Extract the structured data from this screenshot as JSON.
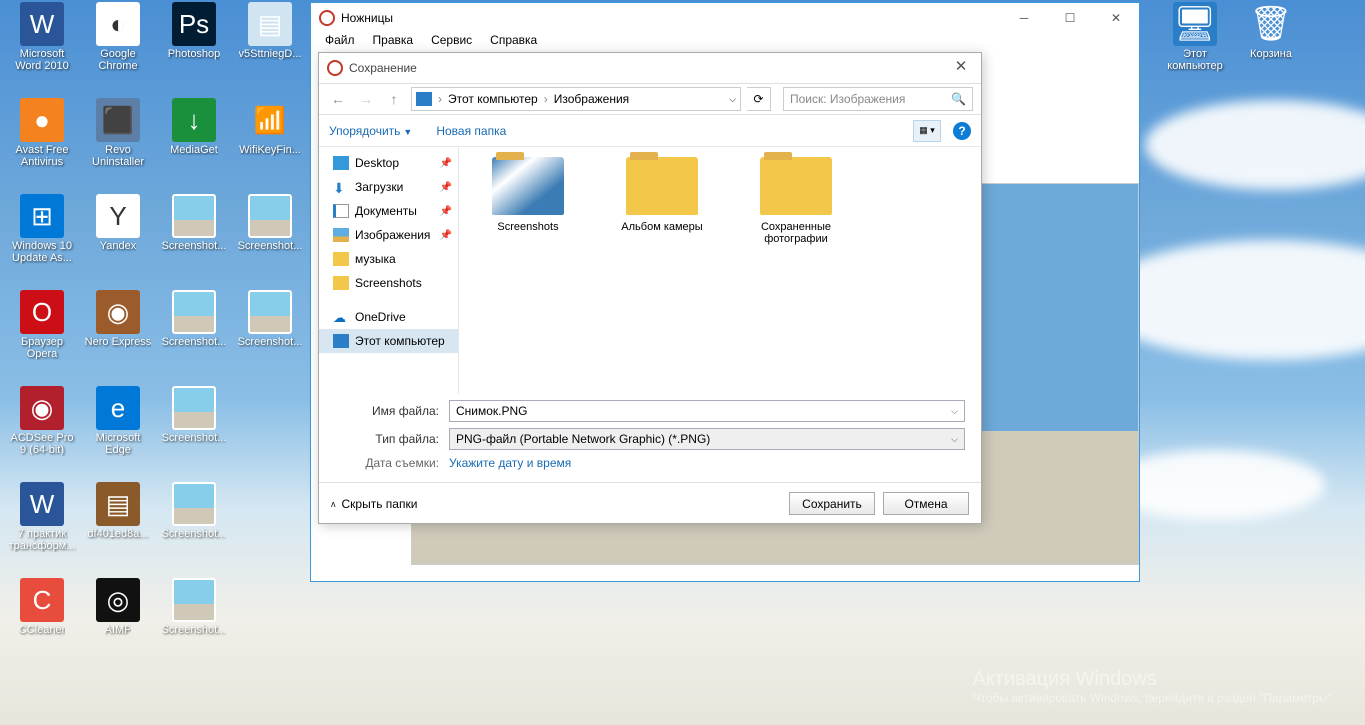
{
  "desktop": {
    "leftColumns": [
      [
        {
          "label": "Microsoft Word 2010",
          "bg": "#2a5699",
          "glyph": "W"
        },
        {
          "label": "Avast Free Antivirus",
          "bg": "#f4821f",
          "glyph": "●"
        },
        {
          "label": "Windows 10 Update As...",
          "bg": "#0078d7",
          "glyph": "⊞"
        },
        {
          "label": "Браузер Opera",
          "bg": "#cc0f16",
          "glyph": "O"
        },
        {
          "label": "ACDSee Pro 9 (64-bit)",
          "bg": "#b21f2d",
          "glyph": "◉"
        },
        {
          "label": "7 практик трансформ...",
          "bg": "#2a5699",
          "glyph": "W"
        },
        {
          "label": "CCleaner",
          "bg": "#e74c3c",
          "glyph": "C"
        }
      ],
      [
        {
          "label": "Google Chrome",
          "bg": "#fff",
          "glyph": "◐"
        },
        {
          "label": "Revo Uninstaller",
          "bg": "#5b7fa6",
          "glyph": "⬛"
        },
        {
          "label": "Yandex",
          "bg": "#fff",
          "glyph": "Y"
        },
        {
          "label": "Nero Express",
          "bg": "#9b5b2a",
          "glyph": "◉"
        },
        {
          "label": "Microsoft Edge",
          "bg": "#0078d7",
          "glyph": "e"
        },
        {
          "label": "df401ed8a...",
          "bg": "#8b5a2b",
          "glyph": "▤"
        },
        {
          "label": "AIMP",
          "bg": "#111",
          "glyph": "◎"
        }
      ],
      [
        {
          "label": "Photoshop",
          "bg": "#001d34",
          "glyph": "Ps"
        },
        {
          "label": "MediaGet",
          "bg": "#1a8f3c",
          "glyph": "↓"
        },
        {
          "label": "Screenshot...",
          "thumb": true
        },
        {
          "label": "Screenshot...",
          "thumb": true
        },
        {
          "label": "Screenshot...",
          "thumb": true
        },
        {
          "label": "Screenshot...",
          "thumb": true
        },
        {
          "label": "Screenshot...",
          "thumb": true
        }
      ],
      [
        {
          "label": "v5SttniegD...",
          "bg": "#d0e4f2",
          "glyph": "▤"
        },
        {
          "label": "WifiKeyFin...",
          "bg": "transparent",
          "glyph": "📶"
        },
        {
          "label": "Screenshot...",
          "thumb": true
        },
        {
          "label": "Screenshot...",
          "thumb": true
        }
      ]
    ],
    "rightColumns": [
      [
        {
          "label": "Этот компьютер",
          "bg": "#2a7ec8",
          "glyph": "🖥"
        }
      ],
      [
        {
          "label": "Корзина",
          "bg": "transparent",
          "glyph": "🗑"
        }
      ]
    ]
  },
  "snip": {
    "title": "Ножницы",
    "menu": [
      "Файл",
      "Правка",
      "Сервис",
      "Справка"
    ]
  },
  "save": {
    "title": "Сохранение",
    "path": {
      "root": "Этот компьютер",
      "cur": "Изображения"
    },
    "searchPlaceholder": "Поиск: Изображения",
    "org": "Упорядочить",
    "newFolder": "Новая папка",
    "tree": [
      {
        "label": "Desktop",
        "icon": "ti-desktop",
        "pin": true
      },
      {
        "label": "Загрузки",
        "icon": "ti-dl",
        "pin": true,
        "glyph": "⬇"
      },
      {
        "label": "Документы",
        "icon": "ti-doc",
        "pin": true
      },
      {
        "label": "Изображения",
        "icon": "ti-pic",
        "pin": true
      },
      {
        "label": "музыка",
        "icon": "ti-music"
      },
      {
        "label": "Screenshots",
        "icon": "ti-ss"
      },
      {
        "label": "OneDrive",
        "icon": "ti-od",
        "glyph": "☁",
        "section": true
      },
      {
        "label": "Этот компьютер",
        "icon": "ti-pc",
        "sel": true
      }
    ],
    "content": [
      {
        "label": "Screenshots",
        "ss": true
      },
      {
        "label": "Альбом камеры"
      },
      {
        "label": "Сохраненные фотографии"
      }
    ],
    "fields": {
      "nameLabel": "Имя файла:",
      "nameValue": "Снимок.PNG",
      "typeLabel": "Тип файла:",
      "typeValue": "PNG-файл (Portable Network Graphic) (*.PNG)",
      "dateLabel": "Дата съемки:",
      "dateHint": "Укажите дату и время"
    },
    "hide": "Скрыть папки",
    "saveBtn": "Сохранить",
    "cancelBtn": "Отмена"
  },
  "watermark": {
    "heading": "Активация Windows",
    "line": "Чтобы активировать Windows, перейдите в раздел \"Параметры\"."
  }
}
